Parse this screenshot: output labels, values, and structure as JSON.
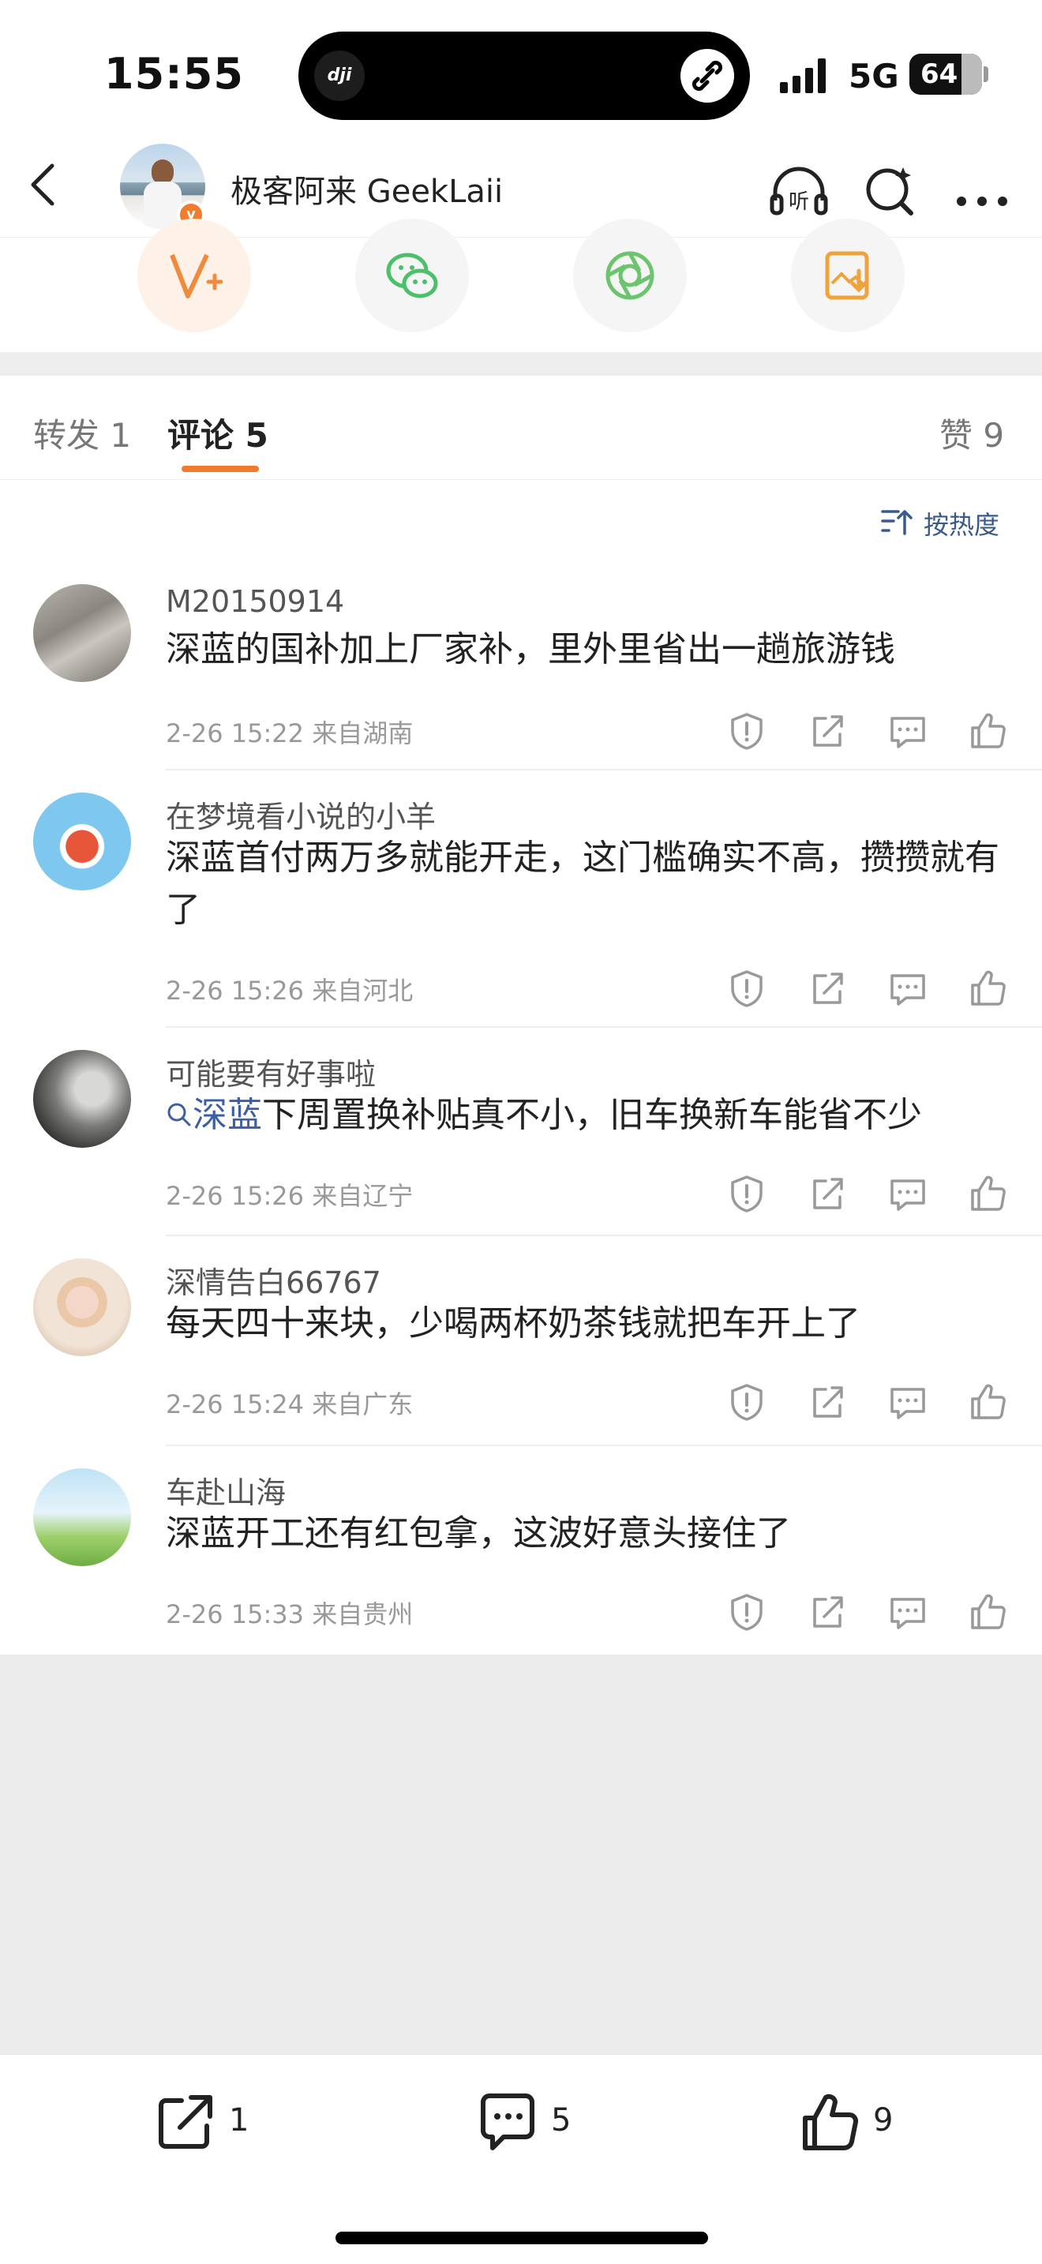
{
  "status_bar": {
    "time": "15:55",
    "network": "5G",
    "battery": "64"
  },
  "header": {
    "title": "极客阿来 GeekLaii"
  },
  "tabs": {
    "repost": "转发 1",
    "comments": "评论 5",
    "likes": "赞 9"
  },
  "sort": {
    "label": "按热度"
  },
  "comments": [
    {
      "name": "M20150914",
      "text": "深蓝的国补加上厂家补，里外里省出一趟旅游钱",
      "meta": "2-26 15:22  来自湖南"
    },
    {
      "name": "在梦境看小说的小羊",
      "text": "深蓝首付两万多就能开走，这门槛确实不高，攒攒就有了",
      "meta": "2-26 15:26  来自河北"
    },
    {
      "name": "可能要有好事啦",
      "topic": "深蓝",
      "text": "下周置换补贴真不小，旧车换新车能省不少",
      "meta": "2-26 15:26  来自辽宁"
    },
    {
      "name": "深情告白66767",
      "text": "每天四十来块，少喝两杯奶茶钱就把车开上了",
      "meta": "2-26 15:24  来自广东"
    },
    {
      "name": "车赴山海",
      "text": "深蓝开工还有红包拿，这波好意头接住了",
      "meta": "2-26 15:33  来自贵州"
    }
  ],
  "bottom_bar": {
    "repost_count": "1",
    "comment_count": "5",
    "like_count": "9"
  },
  "colors": {
    "accent": "#f37a2d",
    "topic": "#3b5fa6",
    "sort": "#3a5a8c",
    "verified": "#f07d2d"
  }
}
